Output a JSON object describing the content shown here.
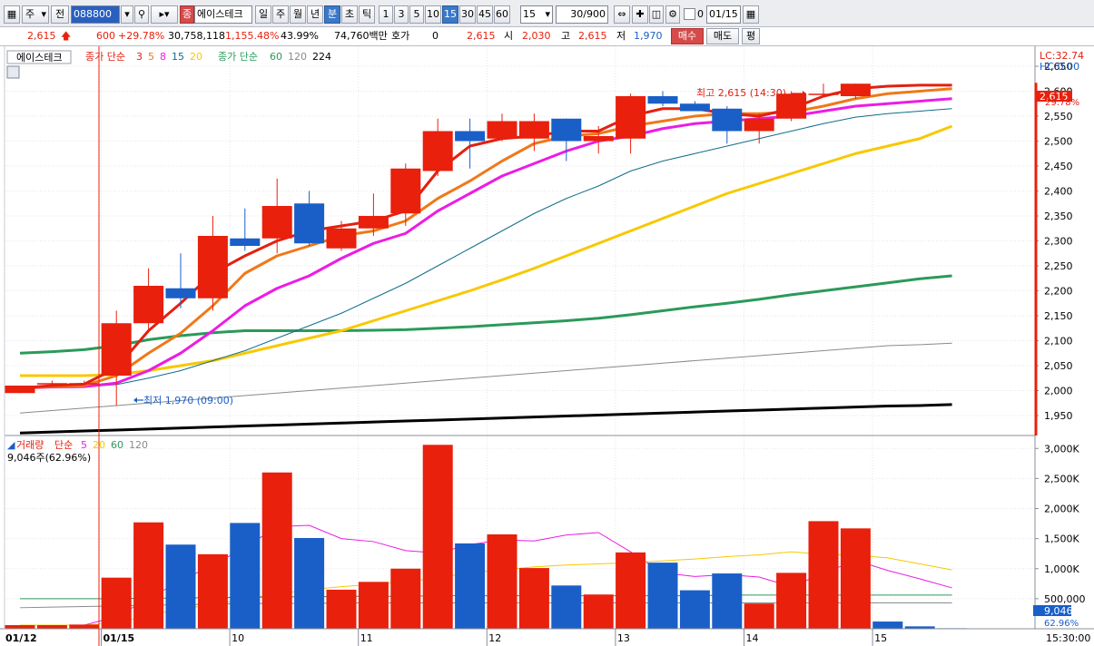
{
  "toolbar": {
    "code_type": "주",
    "market_label": "전",
    "code": "088800",
    "stock_name": "에이스테크",
    "stock_badge": "종",
    "period_tabs": [
      "일",
      "주",
      "월",
      "년",
      "분",
      "초",
      "틱"
    ],
    "active_period": "분",
    "interval_buttons": [
      "1",
      "3",
      "5",
      "10",
      "15",
      "30",
      "45",
      "60"
    ],
    "active_interval": "15",
    "interval_value": "15",
    "count_value": "30/900",
    "date_value": "01/15",
    "date_checkbox_label": "0"
  },
  "quote": {
    "price": "2,615",
    "change": "600",
    "change_rate": "+29.78%",
    "volume": "30,758,118",
    "volume_rate": "1,155.48%",
    "turnover": "43.99%",
    "amount": "74,760백만",
    "bid_label": "호가",
    "bid_value": "0",
    "bid_price": "2,615",
    "open_label": "시",
    "open_value": "2,030",
    "high_label": "고",
    "high_value": "2,615",
    "low_label": "저",
    "low_value": "1,970",
    "buy_button": "매수",
    "sell_button": "매도",
    "eval_button": "평"
  },
  "price_panel": {
    "stock_tag": "에이스테크",
    "ma_label": "종가 단순",
    "ma_periods_short": [
      "3",
      "5",
      "8",
      "15",
      "20"
    ],
    "ma_label_long": "종가 단순",
    "ma_periods_long": [
      "60",
      "120",
      "224"
    ],
    "lc_label": "LC:32.74",
    "hc_label": "HC:0.00",
    "high_annotation": "최고 2,615 (14:30)",
    "low_annotation": "최저 1,970 (09:00)",
    "current_price_tag": "2,615",
    "current_rate_tag": "29.78%"
  },
  "volume_panel": {
    "label": "거래량",
    "ma_label": "단순",
    "ma_periods": [
      "5",
      "20",
      "60",
      "120"
    ],
    "current_label": "9,046주(62.96%)",
    "current_tag": "9,046",
    "current_rate_tag": "62.96%"
  },
  "colors": {
    "up": "#e8200c",
    "down": "#1a5fc8",
    "ma3": "#e32010",
    "ma5": "#f07818",
    "ma8": "#ec1ce4",
    "ma15": "#0f6e8a",
    "ma20": "#f8c800",
    "ma60": "#2a9a5a",
    "ma120": "#8a8a8a",
    "ma224": "#000000"
  },
  "chart_data": {
    "type": "candlestick",
    "interval_minutes": 15,
    "x_date_labels": [
      "01/12",
      "01/15",
      "10",
      "11",
      "12",
      "13",
      "14",
      "15",
      "15:30:00"
    ],
    "price_axis": {
      "ylim": [
        1910,
        2690
      ],
      "ticks": [
        1950,
        2000,
        2050,
        2100,
        2150,
        2200,
        2250,
        2300,
        2350,
        2400,
        2450,
        2500,
        2550,
        2600,
        2650
      ]
    },
    "volume_axis": {
      "ylim": [
        0,
        3200000
      ],
      "ticks": [
        500000,
        1000000,
        1500000,
        2000000,
        2500000,
        3000000
      ],
      "tick_labels": [
        "500,000",
        "1,000K",
        "1,500K",
        "2,000K",
        "2,500K",
        "3,000K"
      ]
    },
    "candles": [
      {
        "o": 1995,
        "h": 2010,
        "l": 1995,
        "c": 2010
      },
      {
        "o": 2015,
        "h": 2020,
        "l": 2010,
        "c": 2015
      },
      {
        "o": 2015,
        "h": 2020,
        "l": 2010,
        "c": 2015
      },
      {
        "o": 2030,
        "h": 2160,
        "l": 1970,
        "c": 2135
      },
      {
        "o": 2135,
        "h": 2245,
        "l": 2120,
        "c": 2210
      },
      {
        "o": 2205,
        "h": 2275,
        "l": 2165,
        "c": 2185
      },
      {
        "o": 2185,
        "h": 2350,
        "l": 2160,
        "c": 2310
      },
      {
        "o": 2305,
        "h": 2365,
        "l": 2280,
        "c": 2290
      },
      {
        "o": 2305,
        "h": 2425,
        "l": 2275,
        "c": 2370
      },
      {
        "o": 2375,
        "h": 2400,
        "l": 2290,
        "c": 2295
      },
      {
        "o": 2285,
        "h": 2340,
        "l": 2280,
        "c": 2325
      },
      {
        "o": 2325,
        "h": 2395,
        "l": 2310,
        "c": 2350
      },
      {
        "o": 2355,
        "h": 2455,
        "l": 2330,
        "c": 2445
      },
      {
        "o": 2440,
        "h": 2545,
        "l": 2430,
        "c": 2520
      },
      {
        "o": 2520,
        "h": 2545,
        "l": 2445,
        "c": 2500
      },
      {
        "o": 2505,
        "h": 2555,
        "l": 2500,
        "c": 2540
      },
      {
        "o": 2505,
        "h": 2555,
        "l": 2480,
        "c": 2540
      },
      {
        "o": 2545,
        "h": 2545,
        "l": 2460,
        "c": 2500
      },
      {
        "o": 2500,
        "h": 2530,
        "l": 2475,
        "c": 2510
      },
      {
        "o": 2505,
        "h": 2595,
        "l": 2475,
        "c": 2590
      },
      {
        "o": 2590,
        "h": 2600,
        "l": 2570,
        "c": 2575
      },
      {
        "o": 2575,
        "h": 2580,
        "l": 2560,
        "c": 2560
      },
      {
        "o": 2565,
        "h": 2570,
        "l": 2495,
        "c": 2520
      },
      {
        "o": 2520,
        "h": 2555,
        "l": 2495,
        "c": 2545
      },
      {
        "o": 2545,
        "h": 2600,
        "l": 2540,
        "c": 2595
      },
      {
        "o": 2595,
        "h": 2615,
        "l": 2590,
        "c": 2595
      },
      {
        "o": 2590,
        "h": 2615,
        "l": 2585,
        "c": 2615
      }
    ],
    "volume": [
      60000,
      60000,
      70000,
      850000,
      1770000,
      1400000,
      1240000,
      1760000,
      2600000,
      1510000,
      650000,
      780000,
      1000000,
      3060000,
      1420000,
      1570000,
      1010000,
      720000,
      570000,
      1270000,
      1100000,
      640000,
      920000,
      420000,
      930000,
      1790000,
      1670000,
      120000,
      40000,
      9046
    ],
    "volume_ma": {
      "ma5": [
        60000,
        60000,
        60000,
        200000,
        500000,
        800000,
        1060000,
        1350000,
        1700000,
        1720000,
        1500000,
        1450000,
        1300000,
        1260000,
        1400000,
        1480000,
        1460000,
        1560000,
        1600000,
        1280000,
        930000,
        870000,
        900000,
        860000,
        700000,
        920000,
        1140000,
        970000,
        830000,
        680000
      ],
      "ma20": [
        60000,
        60000,
        60000,
        100000,
        220000,
        330000,
        400000,
        500000,
        580000,
        650000,
        700000,
        740000,
        780000,
        850000,
        930000,
        980000,
        1030000,
        1060000,
        1080000,
        1100000,
        1130000,
        1160000,
        1200000,
        1230000,
        1280000,
        1240000,
        1220000,
        1180000,
        1080000,
        980000
      ],
      "ma60": [
        500000,
        500000,
        500000,
        500000,
        510000,
        510000,
        520000,
        520000,
        530000,
        530000,
        540000,
        540000,
        540000,
        550000,
        550000,
        550000,
        550000,
        550000,
        550000,
        550000,
        550000,
        550000,
        560000,
        560000,
        560000,
        560000,
        560000,
        560000,
        560000,
        560000
      ],
      "ma120": [
        350000,
        360000,
        370000,
        380000,
        390000,
        400000,
        410000,
        420000,
        420000,
        420000,
        430000,
        430000,
        430000,
        430000,
        430000,
        430000,
        430000,
        430000,
        430000,
        430000,
        430000,
        430000,
        430000,
        430000,
        430000,
        430000,
        430000,
        430000,
        430000,
        430000
      ]
    },
    "price_ma": {
      "ma3": [
        2005,
        2010,
        2013,
        2045,
        2120,
        2175,
        2235,
        2270,
        2300,
        2320,
        2330,
        2340,
        2360,
        2440,
        2490,
        2505,
        2510,
        2520,
        2520,
        2550,
        2565,
        2565,
        2555,
        2550,
        2565,
        2590,
        2605,
        2610,
        2612,
        2612
      ],
      "ma5": [
        2005,
        2008,
        2010,
        2030,
        2075,
        2115,
        2170,
        2235,
        2270,
        2290,
        2310,
        2320,
        2340,
        2385,
        2420,
        2460,
        2495,
        2510,
        2515,
        2530,
        2540,
        2550,
        2555,
        2555,
        2558,
        2570,
        2585,
        2595,
        2600,
        2605
      ],
      "ma8": [
        2005,
        2007,
        2008,
        2015,
        2040,
        2075,
        2120,
        2170,
        2205,
        2230,
        2265,
        2295,
        2315,
        2360,
        2395,
        2430,
        2455,
        2480,
        2500,
        2510,
        2525,
        2535,
        2540,
        2545,
        2550,
        2560,
        2570,
        2575,
        2580,
        2585
      ],
      "ma15": [
        2005,
        2006,
        2007,
        2012,
        2025,
        2040,
        2060,
        2080,
        2105,
        2130,
        2155,
        2185,
        2215,
        2250,
        2285,
        2320,
        2355,
        2385,
        2410,
        2440,
        2460,
        2475,
        2490,
        2505,
        2520,
        2535,
        2548,
        2555,
        2560,
        2565
      ],
      "ma20": [
        2030,
        2030,
        2030,
        2032,
        2040,
        2050,
        2060,
        2075,
        2090,
        2105,
        2120,
        2140,
        2160,
        2180,
        2200,
        2222,
        2245,
        2270,
        2295,
        2320,
        2345,
        2370,
        2395,
        2415,
        2435,
        2455,
        2475,
        2490,
        2505,
        2530
      ],
      "ma60": [
        2075,
        2078,
        2082,
        2090,
        2102,
        2110,
        2116,
        2120,
        2120,
        2120,
        2120,
        2121,
        2122,
        2125,
        2128,
        2132,
        2136,
        2140,
        2145,
        2152,
        2160,
        2168,
        2175,
        2183,
        2192,
        2200,
        2208,
        2216,
        2224,
        2230
      ],
      "ma120": [
        1955,
        1960,
        1965,
        1970,
        1975,
        1980,
        1985,
        1990,
        1995,
        2000,
        2005,
        2010,
        2015,
        2020,
        2025,
        2030,
        2035,
        2040,
        2045,
        2050,
        2055,
        2060,
        2065,
        2070,
        2075,
        2080,
        2085,
        2090,
        2092,
        2095
      ],
      "ma224": [
        1915,
        1917,
        1919,
        1921,
        1923,
        1925,
        1927,
        1929,
        1931,
        1933,
        1935,
        1937,
        1939,
        1941,
        1943,
        1945,
        1947,
        1949,
        1951,
        1953,
        1955,
        1957,
        1959,
        1961,
        1963,
        1965,
        1967,
        1969,
        1970,
        1972
      ]
    }
  }
}
